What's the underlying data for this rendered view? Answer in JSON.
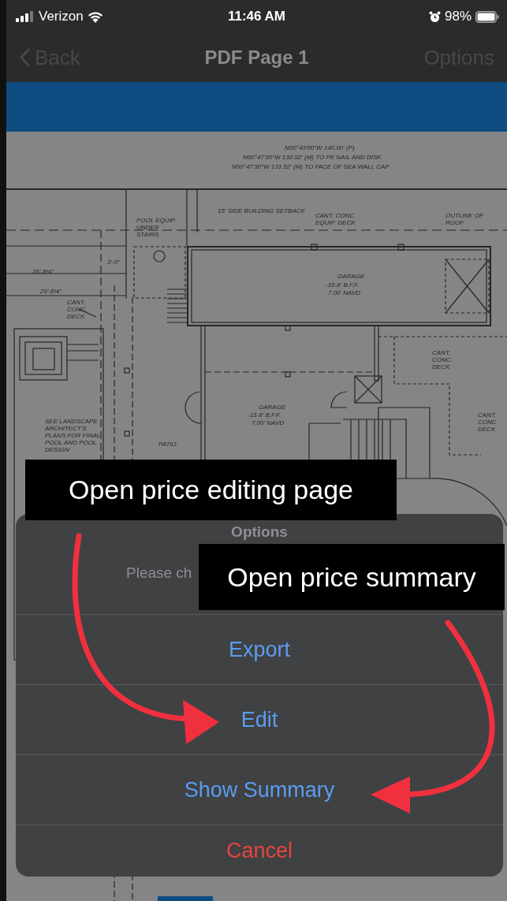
{
  "status_bar": {
    "carrier": "Verizon",
    "time": "11:46 AM",
    "battery": "98%"
  },
  "nav_bar": {
    "back": {
      "label": "Back",
      "disabled": true
    },
    "title": "PDF Page 1",
    "options": {
      "label": "Options",
      "disabled": true
    }
  },
  "plan_labels": [
    "N00°43'00\"W   140.00' (P)",
    "N00°47'30\"W   130.92' (M) TO PK NAIL AND DISK",
    "N00°47'30\"W   131.52' (M) TO FACE OF SEA WALL CAP",
    "15' SIDE BUILDING SETBACK",
    "POOL EQUIP. UNDER STAIRS",
    "CANT. CONC. EQUIP. DECK",
    "OUTLINE OF ROOF",
    "GARAGE",
    "-15-8' B.F.F.",
    "7.00' NAVD",
    "3'-0\"",
    "26'-8⅛\"",
    "29'-8⅛\"",
    "CANT. CONC. DECK",
    "CANT. CONC. DECK",
    "SEE LANDSCAPE ARCHITECT'S PLANS FOR FINAL POOL AND POOL DESIGN",
    "GARAGE",
    "-15-8' B.F.F.",
    "7.00' NAVD",
    "PATIO",
    "CANT. CONC DECK"
  ],
  "action_sheet": {
    "title": "Options",
    "message": "Please ch",
    "actions": [
      {
        "label": "Export",
        "kind": "default"
      },
      {
        "label": "Edit",
        "kind": "default"
      },
      {
        "label": "Show Summary",
        "kind": "default"
      },
      {
        "label": "Cancel",
        "kind": "destructive"
      }
    ]
  },
  "callouts": [
    "Open price editing page",
    "Open price summary"
  ]
}
